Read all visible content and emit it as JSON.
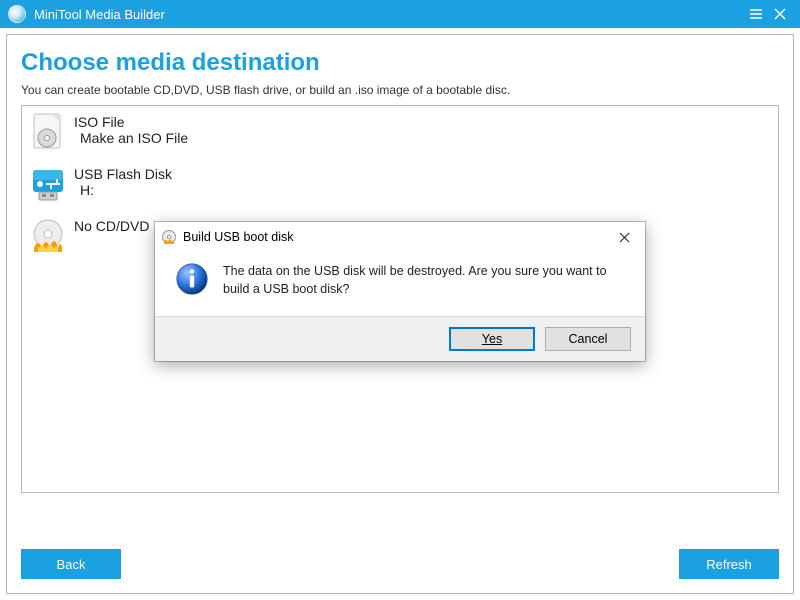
{
  "titlebar": {
    "title": "MiniTool Media Builder"
  },
  "page": {
    "title": "Choose media destination",
    "subtitle": "You can create bootable CD,DVD, USB flash drive, or build an .iso image of a bootable disc."
  },
  "options": [
    {
      "title": "ISO File",
      "subtitle": "Make an ISO File",
      "icon": "iso"
    },
    {
      "title": "USB Flash Disk",
      "subtitle": "H:",
      "icon": "usb"
    },
    {
      "title": "No CD/DVD",
      "subtitle": "",
      "icon": "disc"
    }
  ],
  "footer": {
    "back": "Back",
    "refresh": "Refresh"
  },
  "dialog": {
    "title": "Build USB boot disk",
    "message": "The data on the USB disk will be destroyed. Are you sure you want to build a USB boot disk?",
    "yes": "Yes",
    "cancel": "Cancel"
  }
}
